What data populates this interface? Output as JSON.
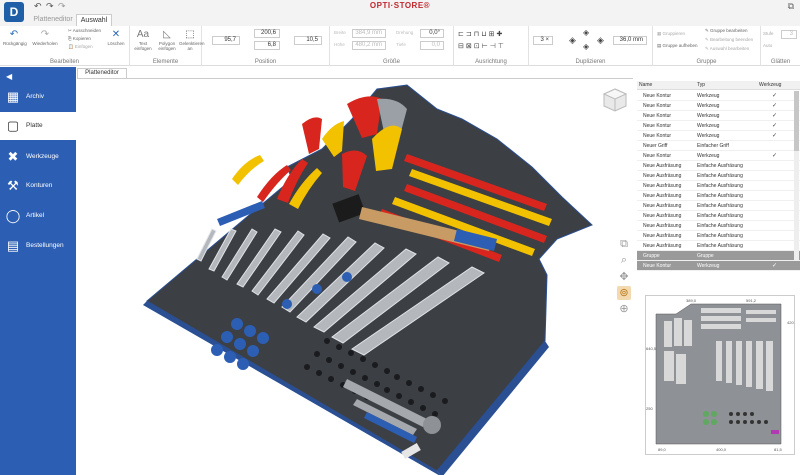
{
  "app": {
    "logo": "D",
    "title": "OPTI·STORE®"
  },
  "tabs": [
    {
      "label": "Platteneditor"
    },
    {
      "label": "Auswahl"
    }
  ],
  "ribbon": {
    "bearbeiten": {
      "label": "Bearbeiten",
      "undo": "Rückgängig",
      "redo": "Wiederholen",
      "cut": "Ausschneiden",
      "copy": "Kopieren",
      "paste": "Einfügen",
      "delete": "Löschen"
    },
    "elemente": {
      "label": "Elemente",
      "text": "Text einfügen",
      "polygon": "Polygon einfügen",
      "align": "Gelenktieren an"
    },
    "position": {
      "label": "Position",
      "x": "95,7",
      "y": "200,6",
      "z": "6,8",
      "w": "10,5"
    },
    "groesse": {
      "label": "Größe",
      "breite_label": "Breite",
      "breite": "384,9 mm",
      "hoehe_label": "Höhe",
      "hoehe": "480,2 mm",
      "drehung_label": "Drehung",
      "drehung": "0,0°",
      "tiefe_label": "Tiefe",
      "tiefe": "0,0"
    },
    "ausrichtung": {
      "label": "Ausrichtung"
    },
    "duplizieren": {
      "label": "Duplizieren",
      "count": "3 ×",
      "distance": "36,0 mm"
    },
    "gruppe": {
      "label": "Gruppe",
      "gruppieren": "Gruppieren",
      "aufheben": "Gruppe aufheben",
      "bearbeiten": "Gruppe bearbeiten",
      "bearbeitung_beenden": "Bearbeitung beenden",
      "auswahl_bearbeiten": "Auswahl bearbeiten"
    },
    "glaetten": {
      "label": "Glätten",
      "stufe": "Stufe",
      "wert": "3",
      "auto": "Auto"
    }
  },
  "sidebar": {
    "items": [
      {
        "label": "Archiv",
        "icon": "grid-icon"
      },
      {
        "label": "Platte",
        "icon": "square-icon"
      },
      {
        "label": "Werkzeuge",
        "icon": "tools-icon"
      },
      {
        "label": "Konturen",
        "icon": "wrench-icon"
      },
      {
        "label": "Artikel",
        "icon": "circle-icon"
      },
      {
        "label": "Bestellungen",
        "icon": "document-icon"
      }
    ]
  },
  "editor": {
    "tab_label": "Platteneditor"
  },
  "table": {
    "headers": [
      "Name",
      "Typ",
      "Werkzeug"
    ],
    "rows": [
      {
        "name": "Neue Kontur",
        "typ": "Werkzeug",
        "check": true
      },
      {
        "name": "Neue Kontur",
        "typ": "Werkzeug",
        "check": true
      },
      {
        "name": "Neue Kontur",
        "typ": "Werkzeug",
        "check": true
      },
      {
        "name": "Neue Kontur",
        "typ": "Werkzeug",
        "check": true
      },
      {
        "name": "Neue Kontur",
        "typ": "Werkzeug",
        "check": true
      },
      {
        "name": "Neuer Griff",
        "typ": "Einfacher Griff",
        "check": false
      },
      {
        "name": "Neue Kontur",
        "typ": "Werkzeug",
        "check": true
      },
      {
        "name": "Neue Ausfräsung",
        "typ": "Einfache Ausfräsung",
        "check": false
      },
      {
        "name": "Neue Ausfräsung",
        "typ": "Einfache Ausfräsung",
        "check": false
      },
      {
        "name": "Neue Ausfräsung",
        "typ": "Einfache Ausfräsung",
        "check": false
      },
      {
        "name": "Neue Ausfräsung",
        "typ": "Einfache Ausfräsung",
        "check": false
      },
      {
        "name": "Neue Ausfräsung",
        "typ": "Einfache Ausfräsung",
        "check": false
      },
      {
        "name": "Neue Ausfräsung",
        "typ": "Einfache Ausfräsung",
        "check": false
      },
      {
        "name": "Neue Ausfräsung",
        "typ": "Einfache Ausfräsung",
        "check": false
      },
      {
        "name": "Neue Ausfräsung",
        "typ": "Einfache Ausfräsung",
        "check": false
      },
      {
        "name": "Neue Ausfräsung",
        "typ": "Einfache Ausfräsung",
        "check": false
      },
      {
        "name": "Gruppe",
        "typ": "Gruppe",
        "check": false
      },
      {
        "name": "Neue Kontur",
        "typ": "Werkzeug",
        "check": true
      }
    ]
  },
  "minimap": {
    "dims": {
      "top1": "389,0",
      "top2": "591,2",
      "right": "420",
      "left": "640,5",
      "left2": "250",
      "bottom1": "89,0",
      "bottom2": "400,0",
      "bottom3": "81,5"
    }
  },
  "colors": {
    "brand": "#2c5fb4",
    "foam": "#3a3d42",
    "accent": "#2a6ab5",
    "tool_red": "#d8261e",
    "tool_yellow": "#f2c200"
  }
}
